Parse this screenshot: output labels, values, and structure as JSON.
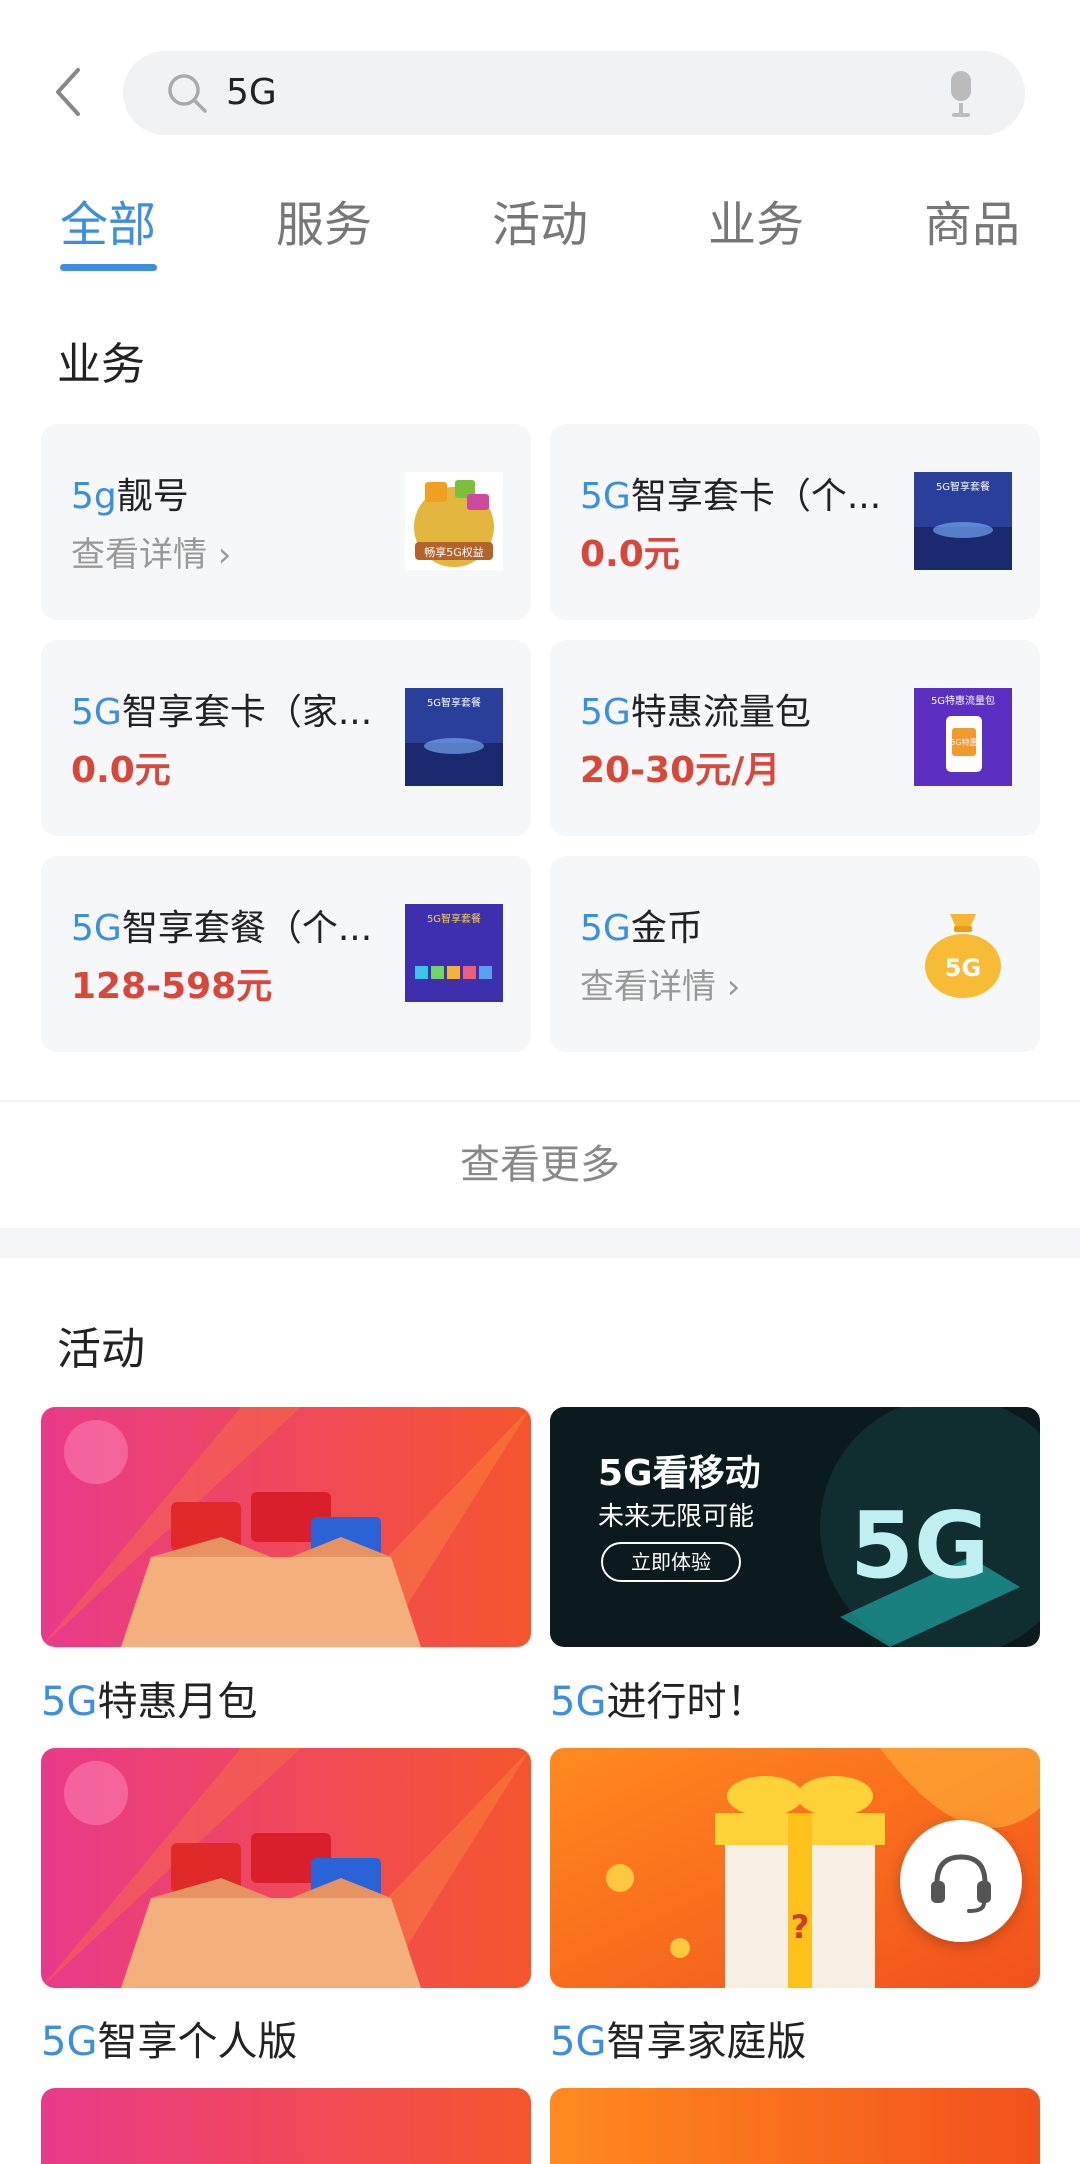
{
  "search": {
    "value": "5G"
  },
  "tabs": [
    {
      "label": "全部",
      "active": true
    },
    {
      "label": "服务"
    },
    {
      "label": "活动"
    },
    {
      "label": "业务"
    },
    {
      "label": "商品"
    }
  ],
  "business": {
    "title": "业务",
    "items": [
      {
        "hl": "5g",
        "rest": "靓号",
        "sub": "查看详情",
        "sub_type": "detail",
        "thumb_text": "畅享5G权益"
      },
      {
        "hl": "5G",
        "rest": "智享套卡（个...",
        "sub": "0.0元",
        "sub_type": "price",
        "thumb_text": "5G智享套餐"
      },
      {
        "hl": "5G",
        "rest": "智享套卡（家...",
        "sub": "0.0元",
        "sub_type": "price",
        "thumb_text": "5G智享套餐"
      },
      {
        "hl": "5G",
        "rest": "特惠流量包",
        "sub": "20-30元/月",
        "sub_type": "price",
        "thumb_text": "5G特惠流量包",
        "thumb_text2": "5G特惠"
      },
      {
        "hl": "5G",
        "rest": "智享套餐（个...",
        "sub": "128-598元",
        "sub_type": "price",
        "thumb_text": "5G智享套餐"
      },
      {
        "hl": "5G",
        "rest": "金币",
        "sub": "查看详情",
        "sub_type": "detail",
        "thumb_text": "5G"
      }
    ],
    "more_label": "查看更多"
  },
  "activity": {
    "title": "活动",
    "items": [
      {
        "hl": "5G",
        "rest": "特惠月包"
      },
      {
        "hl": "5G",
        "rest": "进行时！",
        "banner_title": "5G看移动",
        "banner_sub": "未来无限可能",
        "banner_btn": "立即体验"
      },
      {
        "hl": "5G",
        "rest": "智享个人版"
      },
      {
        "hl": "5G",
        "rest": "智享家庭版"
      }
    ]
  },
  "colors": {
    "accent": "#3b8ee0",
    "price": "#d9473a"
  }
}
